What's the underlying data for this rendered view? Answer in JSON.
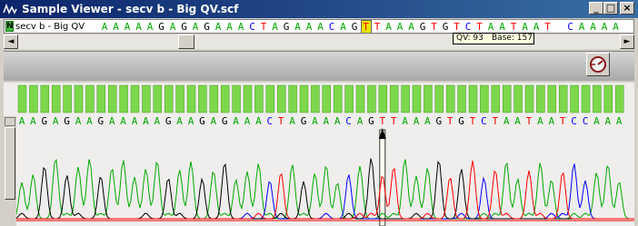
{
  "window": {
    "title": "Sample Viewer - secv b - Big QV.scf",
    "buttons": {
      "minimize": "_",
      "maximize": "□",
      "close": "×"
    }
  },
  "sequence_bar": {
    "badge": "N",
    "sample_name": "secv b - Big QV",
    "bases": "AAAAAGAGAGAAACTAGAAACAGTTAAAGTGTCTAATAAT CAAAA",
    "highlight_base": "T"
  },
  "tooltip": {
    "qv": "QV: 93",
    "base": "Base: 157"
  },
  "scrollbar": {
    "left_arrow": "◄",
    "right_arrow": "►"
  },
  "toolbar": {
    "tool_icon": "settings-gauge-icon"
  },
  "trace": {
    "called_bases": "AAGAGAAGAAAAAGAAGAGAAACTAGAAACAGTTAAAGTGTCTAATAATCCAAA",
    "cursor_base_index": 32,
    "colors": {
      "A": "#00aa00",
      "C": "#0000ff",
      "G": "#000000",
      "T": "#ff0000",
      "quality_bar": "#7cd84a",
      "cursor": "#fffff0"
    }
  }
}
